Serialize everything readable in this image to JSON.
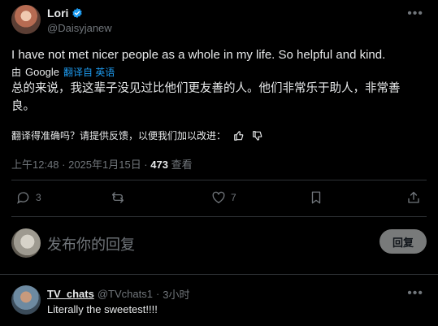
{
  "post": {
    "author_name": "Lori",
    "author_handle": "@Daisyjanew",
    "text_en": "I have not met nicer people as a whole in my life. So helpful and kind.",
    "translation_by": "由",
    "google_label": "Google",
    "translated_from": "翻译自 英语",
    "text_zh": "总的来说，我这辈子没见过比他们更友善的人。他们非常乐于助人，非常善良。",
    "feedback_prompt": "翻译得准确吗？请提供反馈，以便我们加以改进：",
    "timestamp": "上午12:48 · 2025年1月15日 · ",
    "views_count": "473",
    "views_label": "查看",
    "replies_count": "3",
    "likes_count": "7"
  },
  "reply_box": {
    "placeholder": "发布你的回复",
    "button_label": "回复"
  },
  "comments": [
    {
      "name": "TV_chats",
      "handle": "@TVchats1",
      "dot": "·",
      "time": "3小时",
      "text": "Literally the sweetest!!!!"
    }
  ],
  "colors": {
    "accent": "#1d9bf0",
    "muted": "#71767b",
    "text": "#e7e9ea",
    "divider": "#2f3336",
    "background": "#000000"
  }
}
